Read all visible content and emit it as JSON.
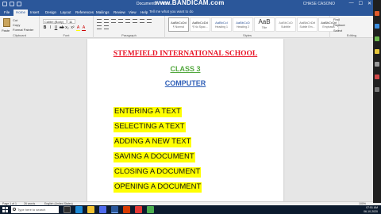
{
  "titlebar": {
    "doc_title": "Document1 - Word",
    "watermark": "www.BANDICAM.com",
    "user": "CHASE CASONO",
    "minimize": "—",
    "maximize": "☐",
    "close": "✕"
  },
  "tabs": [
    "File",
    "Home",
    "Insert",
    "Design",
    "Layout",
    "References",
    "Mailings",
    "Review",
    "View",
    "Help"
  ],
  "tell_me": "Tell me what you want to do",
  "ribbon": {
    "clipboard": {
      "label": "Clipboard",
      "paste": "Paste",
      "cut": "Cut",
      "copy": "Copy",
      "format_painter": "Format Painter"
    },
    "font": {
      "label": "Font",
      "font_name": "Calibri (Body)",
      "font_size": "11",
      "buttons": [
        "B",
        "I",
        "U",
        "ab",
        "x₂",
        "x²",
        "A",
        "A"
      ]
    },
    "paragraph": {
      "label": "Paragraph"
    },
    "styles": {
      "label": "Styles",
      "cards": [
        {
          "sample": "AaBbCcDd",
          "name": "¶ Normal"
        },
        {
          "sample": "AaBbCcDd",
          "name": "¶ No Spac..."
        },
        {
          "sample": "AaBbCcI",
          "name": "Heading 1"
        },
        {
          "sample": "AaBbCcD",
          "name": "Heading 2"
        },
        {
          "sample": "AaB",
          "name": "Title"
        },
        {
          "sample": "AaBbCcD",
          "name": "Subtitle"
        },
        {
          "sample": "AaBbCcDd",
          "name": "Subtle Em..."
        },
        {
          "sample": "AaBbCcDd",
          "name": "Emphasis"
        },
        {
          "sample": "AaBbCcDd",
          "name": "Intense E..."
        }
      ]
    },
    "editing": {
      "label": "Editing",
      "find": "Find",
      "replace": "Replace",
      "select": "Select"
    }
  },
  "document": {
    "school": "STEMFIELD INTERNATIONAL SCHOOL",
    "class": "CLASS 3",
    "subject": "COMPUTER",
    "topics": [
      "ENTERING A TEXT",
      "SELECTING A TEXT",
      "ADDING A NEW TEXT",
      "SAVING A DOCUMENT",
      "CLOSING A DOCUMENT",
      "OPENING A DOCUMENT"
    ],
    "highlight_color": "#ffff00",
    "school_color": "#e8182a",
    "class_color": "#53a83e",
    "subject_color": "#3060b8"
  },
  "statusbar": {
    "page": "Page 1 of 1",
    "words": "26 words",
    "language": "English (United States)",
    "zoom": "100%"
  },
  "taskbar": {
    "search_placeholder": "Type here to search",
    "time": "07:51 AM",
    "date": "06-10-2020"
  },
  "colors": {
    "word_blue": "#2b579a",
    "taskbar": "#0c1b2e"
  }
}
